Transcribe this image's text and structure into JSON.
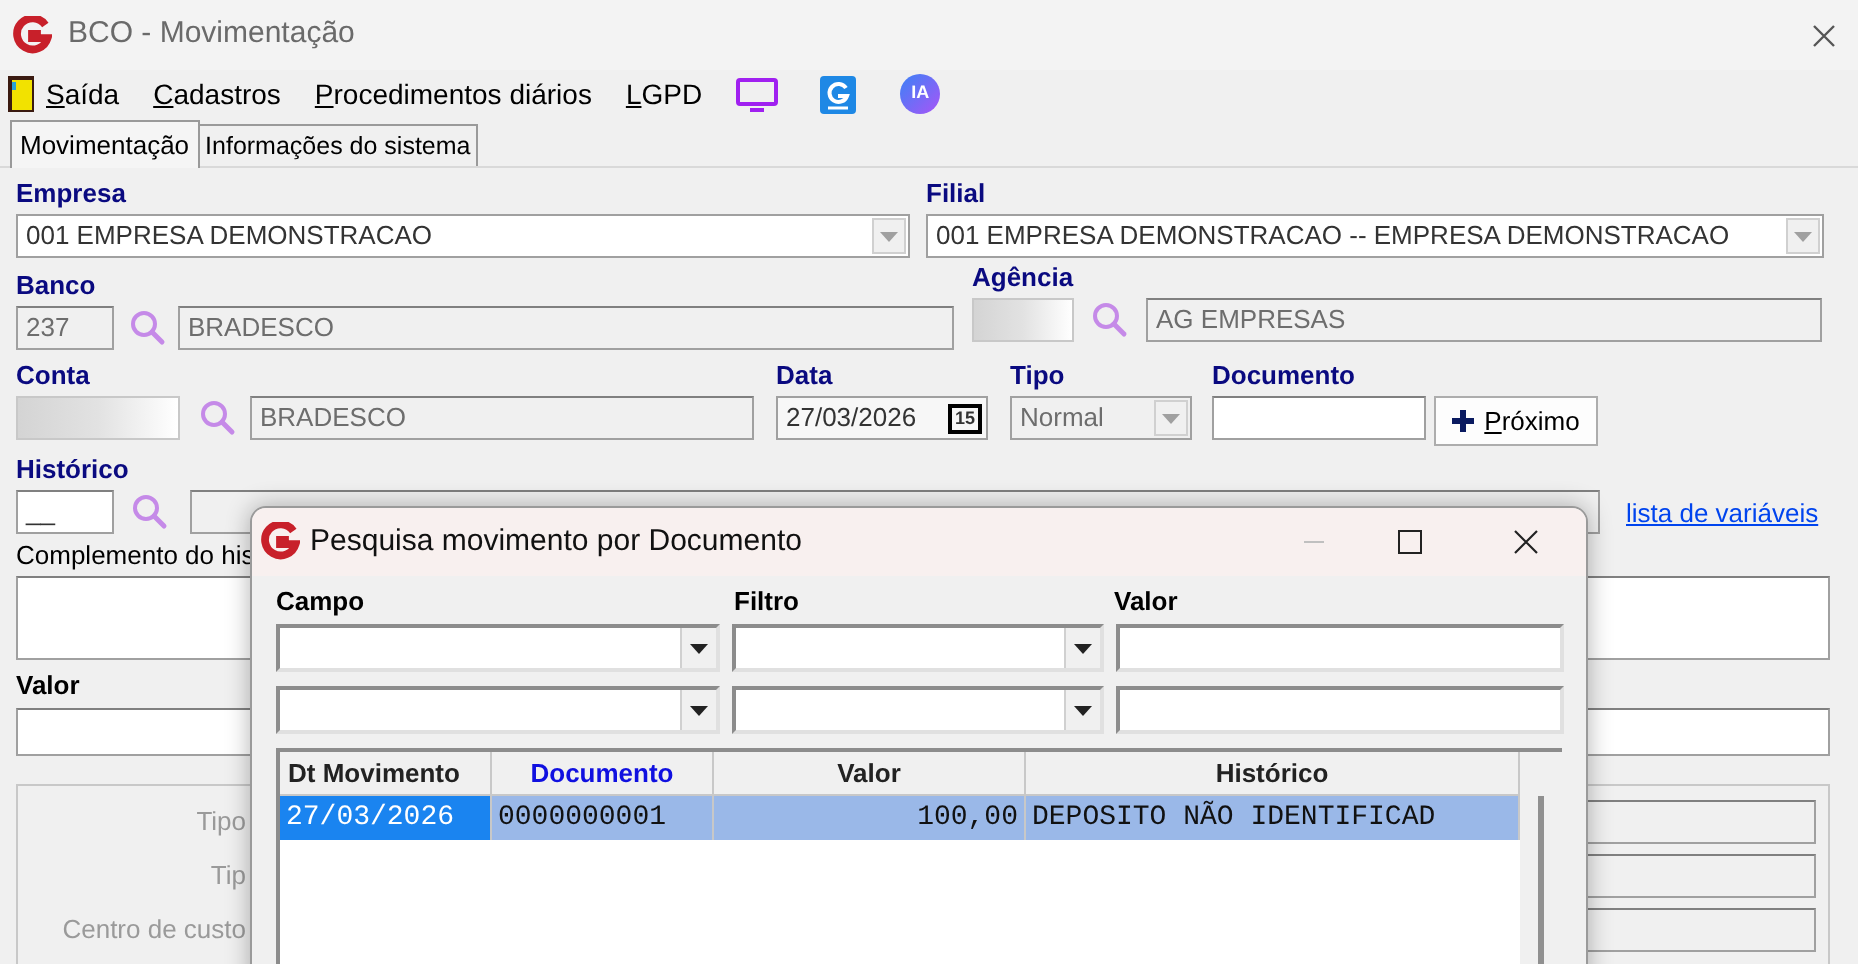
{
  "window": {
    "title": "BCO - Movimentação"
  },
  "menu": [
    {
      "label": "Saída",
      "kind": "exit"
    },
    {
      "label": "Cadastros",
      "kind": "text"
    },
    {
      "label": "Procedimentos diários",
      "kind": "text"
    },
    {
      "label": "LGPD",
      "kind": "text"
    },
    {
      "kind": "monitor"
    },
    {
      "kind": "logo"
    },
    {
      "label": "IA",
      "kind": "badge"
    }
  ],
  "tabs": [
    {
      "label": "Movimentação",
      "selected": true
    },
    {
      "label": "Informações do sistema",
      "selected": false
    }
  ],
  "form": {
    "empresa": {
      "label": "Empresa",
      "value": "001 EMPRESA DEMONSTRACAO"
    },
    "filial": {
      "label": "Filial",
      "value": "001 EMPRESA DEMONSTRACAO -- EMPRESA DEMONSTRACAO"
    },
    "banco": {
      "label": "Banco",
      "code": "237",
      "name": "BRADESCO"
    },
    "agencia": {
      "label": "Agência",
      "name": "AG EMPRESAS"
    },
    "conta": {
      "label": "Conta",
      "name": "BRADESCO"
    },
    "data": {
      "label": "Data",
      "value": "27/03/2026",
      "calendar": "15"
    },
    "tipo": {
      "label": "Tipo",
      "value": "Normal"
    },
    "documento": {
      "label": "Documento"
    },
    "next_button": "Próximo",
    "historico": {
      "label": "Histórico",
      "code": "__"
    },
    "variables_link": "lista de variáveis",
    "complemento": {
      "label": "Complemento do his"
    },
    "valor": {
      "label": "Valor"
    },
    "group_labels": [
      "Tipo",
      "Tip",
      "Centro de custo"
    ]
  },
  "dialog": {
    "title": "Pesquisa movimento por Documento",
    "filter_labels": [
      "Campo",
      "Filtro",
      "Valor"
    ],
    "grid": {
      "columns": [
        {
          "label": "Dt Movimento",
          "sorted": false
        },
        {
          "label": "Documento",
          "sorted": true
        },
        {
          "label": "Valor",
          "sorted": false
        },
        {
          "label": "Histórico",
          "sorted": false
        }
      ],
      "rows": [
        {
          "selected": true,
          "cells": [
            {
              "text": "27/03/2026",
              "focused": true
            },
            {
              "text": "0000000001",
              "focused": false
            },
            {
              "text": "100,00",
              "focused": false
            },
            {
              "text": "DEPOSITO NÃO IDENTIFICAD",
              "focused": false
            }
          ]
        }
      ]
    }
  }
}
